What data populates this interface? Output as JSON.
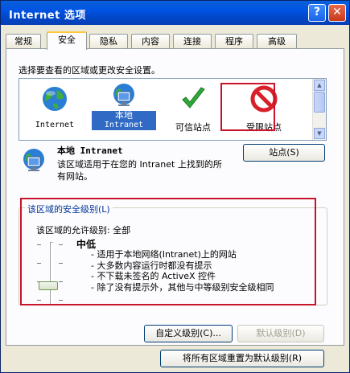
{
  "window": {
    "title": "Internet 选项",
    "help_glyph": "?",
    "close_glyph": "✕"
  },
  "tabs": [
    {
      "label": "常规"
    },
    {
      "label": "安全"
    },
    {
      "label": "隐私"
    },
    {
      "label": "内容"
    },
    {
      "label": "连接"
    },
    {
      "label": "程序"
    },
    {
      "label": "高级"
    }
  ],
  "security": {
    "instruction": "选择要查看的区域或更改安全设置。",
    "zones": [
      {
        "label": "Internet",
        "icon": "globe-icon"
      },
      {
        "label_line1": "本地",
        "label_line2": "Intranet",
        "icon": "monitor-network-icon"
      },
      {
        "label": "可信站点",
        "icon": "checkmark-icon"
      },
      {
        "label": "受限站点",
        "icon": "restricted-icon"
      }
    ],
    "selected_zone": {
      "name": "本地 Intranet",
      "description": "该区域适用于在您的 Intranet 上找到的所有网站。"
    },
    "sites_button": "站点(S)",
    "level_group": {
      "title": "该区域的安全级别(L)",
      "allowed": "该区域的允许级别: 全部",
      "level": "中低",
      "bullets": [
        "- 适用于本地网络(Intranet)上的网站",
        "- 大多数内容运行时都没有提示",
        "- 不下载未签名的 ActiveX 控件",
        "- 除了没有提示外，其他与中等级别安全级相同"
      ],
      "slider_level_fraction": 0.75
    },
    "custom_level_button": "自定义级别(C)...",
    "default_level_button": "默认级别(D)",
    "reset_all_button": "将所有区域重置为默认级别(R)"
  },
  "colors": {
    "highlight_red": "#c8142a",
    "group_title": "#003399",
    "selection": "#316ac5"
  }
}
